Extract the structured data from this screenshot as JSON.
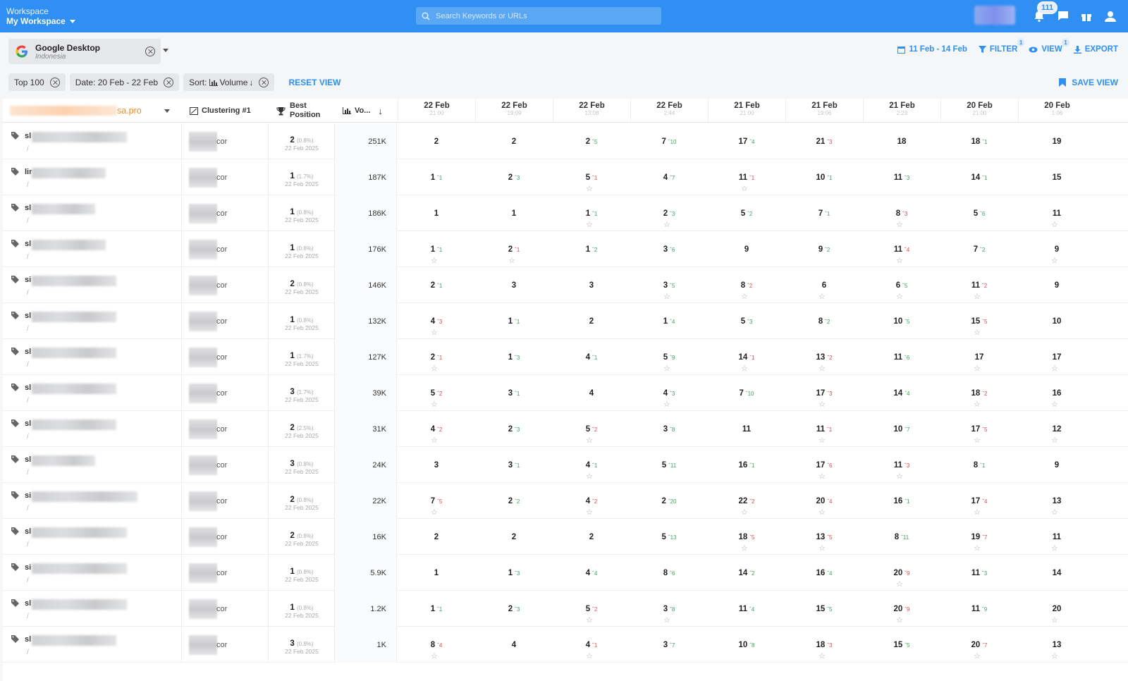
{
  "topbar": {
    "workspace_label": "Workspace",
    "workspace_name": "My Workspace",
    "search_placeholder": "Search Keywords or URLs",
    "notif_count": "111"
  },
  "engine": {
    "title": "Google Desktop",
    "subtitle": "Indonesia"
  },
  "actions": {
    "date_range": "11 Feb - 14 Feb",
    "filter": "FILTER",
    "filter_count": "1",
    "view": "VIEW",
    "view_count": "1",
    "export": "EXPORT"
  },
  "chips": {
    "top": "Top 100",
    "date": "Date: 20 Feb - 22 Feb",
    "sort_prefix": "Sort:",
    "sort_value": "Volume",
    "reset": "RESET VIEW",
    "save": "SAVE VIEW"
  },
  "headers": {
    "domain_suffix": "sa.pro",
    "clustering": "Clustering #1",
    "best_position_1": "Best",
    "best_position_2": "Position",
    "volume": "Vo..."
  },
  "date_columns": [
    {
      "date": "22 Feb",
      "time": "21:00"
    },
    {
      "date": "22 Feb",
      "time": "19:09"
    },
    {
      "date": "22 Feb",
      "time": "13:08"
    },
    {
      "date": "22 Feb",
      "time": "2:44"
    },
    {
      "date": "21 Feb",
      "time": "21:00"
    },
    {
      "date": "21 Feb",
      "time": "19:06"
    },
    {
      "date": "21 Feb",
      "time": "2:29"
    },
    {
      "date": "20 Feb",
      "time": "21:00"
    },
    {
      "date": "20 Feb",
      "time": "1:06"
    }
  ],
  "rows": [
    {
      "kw": "sl",
      "blur": 135,
      "cluster": "cor",
      "best": "2",
      "pct": "(0.8%)",
      "best_date": "22 Feb 2025",
      "vol": "251K",
      "pos": [
        [
          "2",
          "",
          0
        ],
        [
          "2",
          "",
          0
        ],
        [
          "2",
          "+5",
          0
        ],
        [
          "7",
          "+10",
          0
        ],
        [
          "17",
          "+4",
          0
        ],
        [
          "21",
          "-3",
          0
        ],
        [
          "18",
          "",
          0
        ],
        [
          "18",
          "+1",
          0
        ],
        [
          "19",
          "",
          0
        ]
      ]
    },
    {
      "kw": "lir",
      "blur": 105,
      "cluster": "cor",
      "best": "1",
      "pct": "(1.7%)",
      "best_date": "22 Feb 2025",
      "vol": "187K",
      "pos": [
        [
          "1",
          "+1",
          0
        ],
        [
          "2",
          "+3",
          0
        ],
        [
          "5",
          "-1",
          1
        ],
        [
          "4",
          "+7",
          0
        ],
        [
          "11",
          "-1",
          1
        ],
        [
          "10",
          "+1",
          0
        ],
        [
          "11",
          "+3",
          0
        ],
        [
          "14",
          "+1",
          0
        ],
        [
          "15",
          "",
          0
        ]
      ]
    },
    {
      "kw": "sl",
      "blur": 90,
      "cluster": "cor",
      "best": "1",
      "pct": "(0.8%)",
      "best_date": "22 Feb 2025",
      "vol": "186K",
      "pos": [
        [
          "1",
          "",
          0
        ],
        [
          "1",
          "",
          0
        ],
        [
          "1",
          "+1",
          1
        ],
        [
          "2",
          "+3",
          1
        ],
        [
          "5",
          "+2",
          0
        ],
        [
          "7",
          "+1",
          0
        ],
        [
          "8",
          "-3",
          1
        ],
        [
          "5",
          "+6",
          0
        ],
        [
          "11",
          "",
          1
        ]
      ]
    },
    {
      "kw": "sl",
      "blur": 105,
      "cluster": "cor",
      "best": "1",
      "pct": "(0.8%)",
      "best_date": "22 Feb 2025",
      "vol": "176K",
      "pos": [
        [
          "1",
          "+1",
          1
        ],
        [
          "2",
          "-1",
          1
        ],
        [
          "1",
          "+2",
          0
        ],
        [
          "3",
          "+6",
          0
        ],
        [
          "9",
          "",
          0
        ],
        [
          "9",
          "+2",
          0
        ],
        [
          "11",
          "-4",
          1
        ],
        [
          "7",
          "+2",
          0
        ],
        [
          "9",
          "",
          1
        ]
      ]
    },
    {
      "kw": "si",
      "blur": 120,
      "cluster": "cor",
      "best": "2",
      "pct": "(0.8%)",
      "best_date": "22 Feb 2025",
      "vol": "146K",
      "pos": [
        [
          "2",
          "+1",
          0
        ],
        [
          "3",
          "",
          0
        ],
        [
          "3",
          "",
          0
        ],
        [
          "3",
          "+5",
          1
        ],
        [
          "8",
          "-2",
          1
        ],
        [
          "6",
          "",
          1
        ],
        [
          "6",
          "+5",
          1
        ],
        [
          "11",
          "-2",
          1
        ],
        [
          "9",
          "",
          0
        ]
      ]
    },
    {
      "kw": "sl",
      "blur": 120,
      "cluster": "cor",
      "best": "1",
      "pct": "(0.8%)",
      "best_date": "22 Feb 2025",
      "vol": "132K",
      "pos": [
        [
          "4",
          "-3",
          1
        ],
        [
          "1",
          "+1",
          0
        ],
        [
          "2",
          "",
          0
        ],
        [
          "1",
          "+4",
          0
        ],
        [
          "5",
          "+3",
          0
        ],
        [
          "8",
          "+2",
          0
        ],
        [
          "10",
          "+5",
          0
        ],
        [
          "15",
          "-5",
          1
        ],
        [
          "10",
          "",
          0
        ]
      ]
    },
    {
      "kw": "sl",
      "blur": 120,
      "cluster": "cor",
      "best": "1",
      "pct": "(1.7%)",
      "best_date": "22 Feb 2025",
      "vol": "127K",
      "pos": [
        [
          "2",
          "-1",
          1
        ],
        [
          "1",
          "+3",
          0
        ],
        [
          "4",
          "+1",
          0
        ],
        [
          "5",
          "+9",
          1
        ],
        [
          "14",
          "-1",
          1
        ],
        [
          "13",
          "-2",
          1
        ],
        [
          "11",
          "+6",
          0
        ],
        [
          "17",
          "",
          1
        ],
        [
          "17",
          "",
          1
        ]
      ]
    },
    {
      "kw": "sl",
      "blur": 120,
      "cluster": "cor",
      "best": "3",
      "pct": "(1.7%)",
      "best_date": "22 Feb 2025",
      "vol": "39K",
      "pos": [
        [
          "5",
          "-2",
          1
        ],
        [
          "3",
          "+1",
          0
        ],
        [
          "4",
          "",
          0
        ],
        [
          "4",
          "+3",
          1
        ],
        [
          "7",
          "+10",
          0
        ],
        [
          "17",
          "-3",
          1
        ],
        [
          "14",
          "+4",
          0
        ],
        [
          "18",
          "-2",
          1
        ],
        [
          "16",
          "",
          1
        ]
      ]
    },
    {
      "kw": "sl",
      "blur": 120,
      "cluster": "cor",
      "best": "2",
      "pct": "(2.5%)",
      "best_date": "22 Feb 2025",
      "vol": "31K",
      "pos": [
        [
          "4",
          "-2",
          1
        ],
        [
          "2",
          "+3",
          0
        ],
        [
          "5",
          "-2",
          1
        ],
        [
          "3",
          "+8",
          0
        ],
        [
          "11",
          "",
          0
        ],
        [
          "11",
          "-1",
          1
        ],
        [
          "10",
          "+7",
          0
        ],
        [
          "17",
          "-5",
          1
        ],
        [
          "12",
          "",
          1
        ]
      ]
    },
    {
      "kw": "sl",
      "blur": 90,
      "cluster": "cor",
      "best": "3",
      "pct": "(0.8%)",
      "best_date": "22 Feb 2025",
      "vol": "24K",
      "pos": [
        [
          "3",
          "",
          0
        ],
        [
          "3",
          "+1",
          0
        ],
        [
          "4",
          "+1",
          1
        ],
        [
          "5",
          "+11",
          0
        ],
        [
          "16",
          "+1",
          0
        ],
        [
          "17",
          "-6",
          1
        ],
        [
          "11",
          "-3",
          1
        ],
        [
          "8",
          "+1",
          0
        ],
        [
          "9",
          "",
          0
        ]
      ]
    },
    {
      "kw": "si",
      "blur": 150,
      "cluster": "cor",
      "best": "2",
      "pct": "(0.8%)",
      "best_date": "22 Feb 2025",
      "vol": "22K",
      "pos": [
        [
          "7",
          "-5",
          1
        ],
        [
          "2",
          "+2",
          0
        ],
        [
          "4",
          "-2",
          1
        ],
        [
          "2",
          "+20",
          0
        ],
        [
          "22",
          "-2",
          1
        ],
        [
          "20",
          "-4",
          1
        ],
        [
          "16",
          "+1",
          0
        ],
        [
          "17",
          "-4",
          1
        ],
        [
          "13",
          "",
          1
        ]
      ]
    },
    {
      "kw": "sl",
      "blur": 135,
      "cluster": "cor",
      "best": "2",
      "pct": "(0.8%)",
      "best_date": "22 Feb 2025",
      "vol": "16K",
      "pos": [
        [
          "2",
          "",
          0
        ],
        [
          "2",
          "",
          0
        ],
        [
          "2",
          "",
          0
        ],
        [
          "5",
          "+13",
          0
        ],
        [
          "18",
          "-5",
          1
        ],
        [
          "13",
          "-5",
          1
        ],
        [
          "8",
          "+11",
          0
        ],
        [
          "19",
          "-7",
          1
        ],
        [
          "11",
          "",
          1
        ]
      ]
    },
    {
      "kw": "si",
      "blur": 135,
      "cluster": "cor",
      "best": "1",
      "pct": "(0.8%)",
      "best_date": "22 Feb 2025",
      "vol": "5.9K",
      "pos": [
        [
          "1",
          "",
          0
        ],
        [
          "1",
          "+3",
          0
        ],
        [
          "4",
          "+4",
          0
        ],
        [
          "8",
          "+6",
          0
        ],
        [
          "14",
          "+2",
          0
        ],
        [
          "16",
          "+4",
          0
        ],
        [
          "20",
          "-9",
          1
        ],
        [
          "11",
          "+3",
          0
        ],
        [
          "14",
          "",
          0
        ]
      ]
    },
    {
      "kw": "sl",
      "blur": 135,
      "cluster": "cor",
      "best": "1",
      "pct": "(0.8%)",
      "best_date": "22 Feb 2025",
      "vol": "1.2K",
      "pos": [
        [
          "1",
          "+1",
          0
        ],
        [
          "2",
          "+3",
          0
        ],
        [
          "5",
          "-2",
          1
        ],
        [
          "3",
          "+8",
          1
        ],
        [
          "11",
          "+4",
          0
        ],
        [
          "15",
          "+5",
          0
        ],
        [
          "20",
          "-9",
          1
        ],
        [
          "11",
          "+9",
          0
        ],
        [
          "20",
          "",
          1
        ]
      ]
    },
    {
      "kw": "sl",
      "blur": 120,
      "cluster": "cor",
      "best": "3",
      "pct": "(0.8%)",
      "best_date": "22 Feb 2025",
      "vol": "1K",
      "pos": [
        [
          "8",
          "-4",
          1
        ],
        [
          "4",
          "",
          0
        ],
        [
          "4",
          "-1",
          1
        ],
        [
          "3",
          "+7",
          0
        ],
        [
          "10",
          "+8",
          0
        ],
        [
          "18",
          "-3",
          1
        ],
        [
          "15",
          "+5",
          0
        ],
        [
          "20",
          "-7",
          1
        ],
        [
          "13",
          "",
          1
        ]
      ]
    }
  ]
}
